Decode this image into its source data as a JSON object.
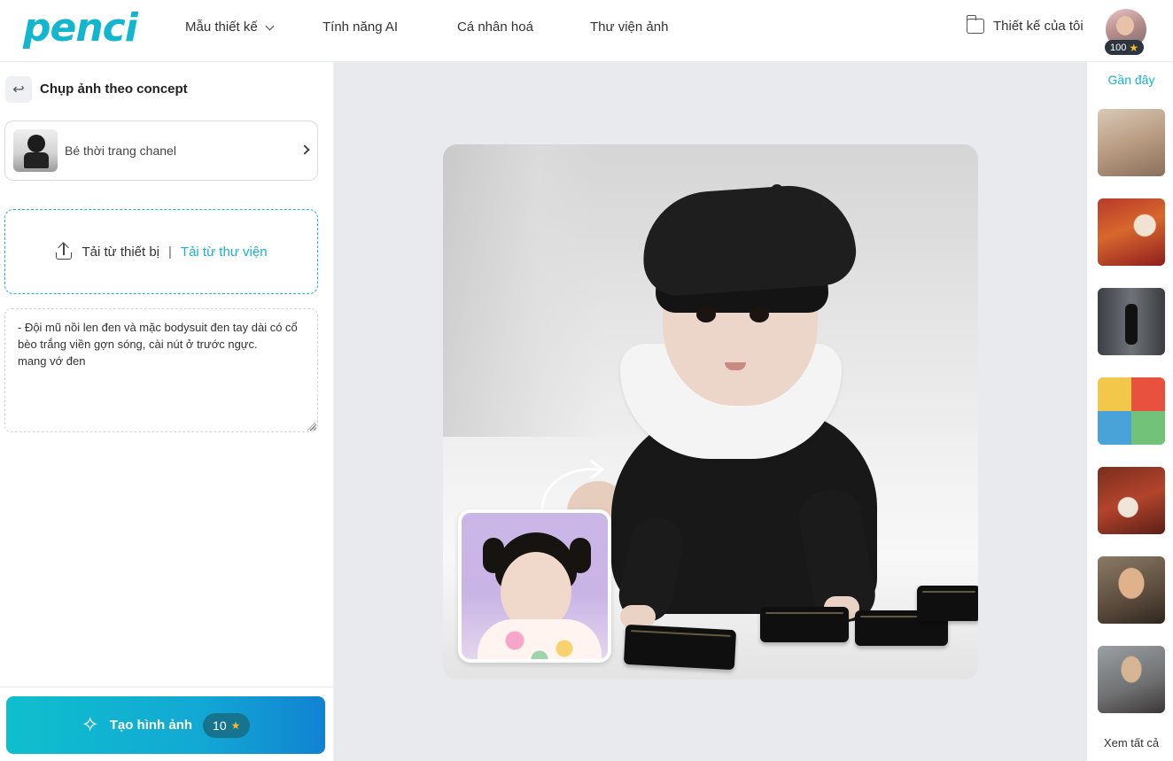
{
  "brand": {
    "logo_text": "penci",
    "accent": "#17b3c8"
  },
  "header": {
    "nav": [
      {
        "label": "Mẫu thiết kế",
        "has_dropdown": true
      },
      {
        "label": "Tính năng AI"
      },
      {
        "label": "Cá nhân hoá"
      },
      {
        "label": "Thư viện ảnh"
      }
    ],
    "my_designs_label": "Thiết kế của tôi",
    "credits": "100"
  },
  "left_panel": {
    "title": "Chụp ảnh theo concept",
    "concept_label": "Bé thời trang chanel",
    "upload_device_label": "Tải từ thiết bị",
    "upload_separator": "|",
    "upload_library_label": "Tải từ thư viện",
    "prompt_text": "- Đội mũ nồi len đen và mặc bodysuit đen tay dài có cổ bèo trắng viền gợn sóng, cài nút ở trước ngực.\nmang vớ đen",
    "generate_label": "Tạo hình ảnh",
    "generate_cost": "10"
  },
  "right_panel": {
    "recent_title": "Gần đây",
    "see_all_label": "Xem tất cả"
  }
}
